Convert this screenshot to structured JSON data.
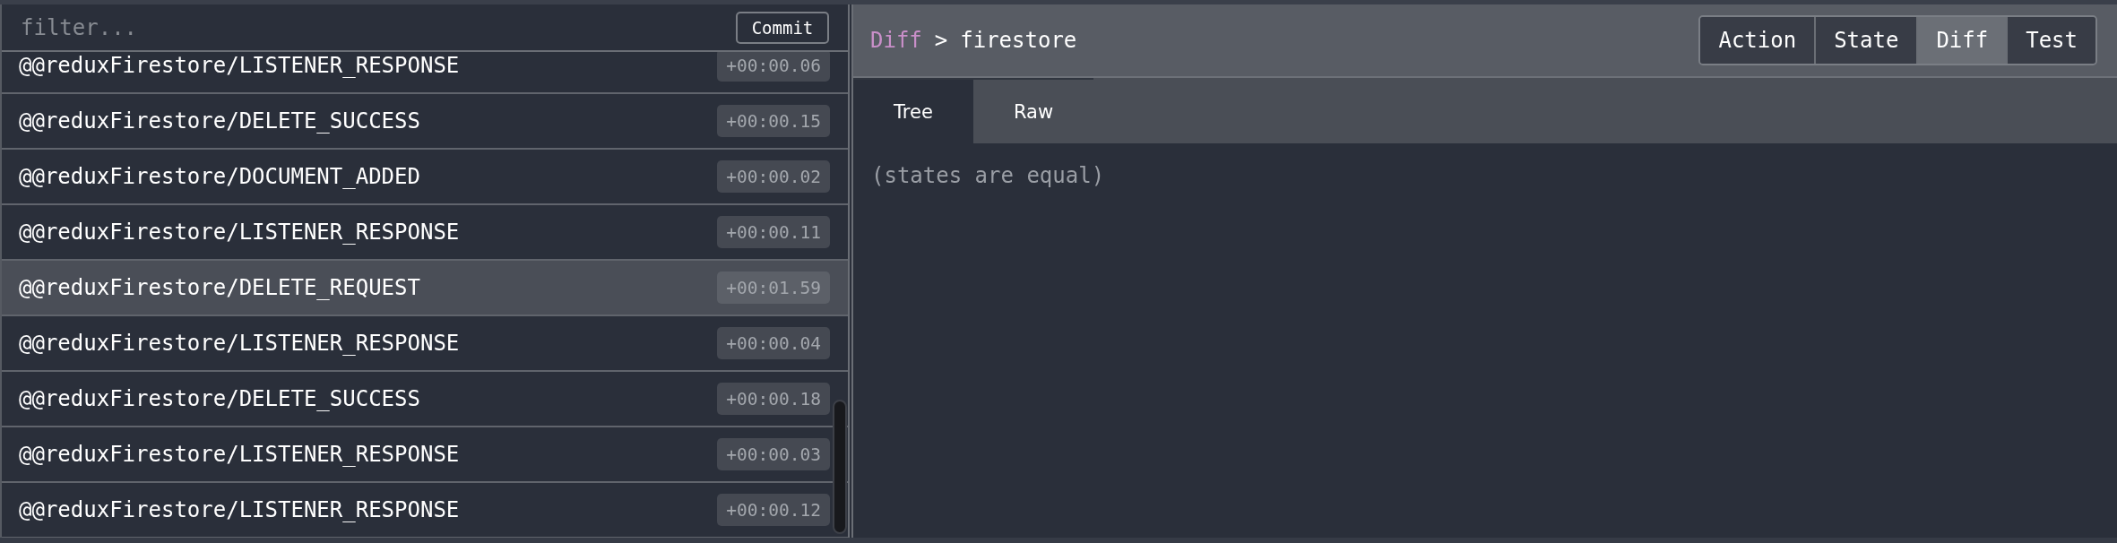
{
  "filter": {
    "placeholder": "filter..."
  },
  "commit_button": {
    "label": "Commit"
  },
  "actions": [
    {
      "name": "@@reduxFirestore/LISTENER_RESPONSE",
      "time": "+00:00.06",
      "selected": false
    },
    {
      "name": "@@reduxFirestore/DELETE_SUCCESS",
      "time": "+00:00.15",
      "selected": false
    },
    {
      "name": "@@reduxFirestore/DOCUMENT_ADDED",
      "time": "+00:00.02",
      "selected": false
    },
    {
      "name": "@@reduxFirestore/LISTENER_RESPONSE",
      "time": "+00:00.11",
      "selected": false
    },
    {
      "name": "@@reduxFirestore/DELETE_REQUEST",
      "time": "+00:01.59",
      "selected": true
    },
    {
      "name": "@@reduxFirestore/LISTENER_RESPONSE",
      "time": "+00:00.04",
      "selected": false
    },
    {
      "name": "@@reduxFirestore/DELETE_SUCCESS",
      "time": "+00:00.18",
      "selected": false
    },
    {
      "name": "@@reduxFirestore/LISTENER_RESPONSE",
      "time": "+00:00.03",
      "selected": false
    },
    {
      "name": "@@reduxFirestore/LISTENER_RESPONSE",
      "time": "+00:00.12",
      "selected": false
    }
  ],
  "header": {
    "breadcrumb": {
      "section": "Diff",
      "separator": ">",
      "path": "firestore"
    }
  },
  "monitor_tabs": [
    {
      "label": "Action",
      "selected": false
    },
    {
      "label": "State",
      "selected": false
    },
    {
      "label": "Diff",
      "selected": true
    },
    {
      "label": "Test",
      "selected": false
    }
  ],
  "view_tabs": [
    {
      "label": "Tree",
      "selected": true
    },
    {
      "label": "Raw",
      "selected": false
    }
  ],
  "content": {
    "message": "(states are equal)"
  }
}
